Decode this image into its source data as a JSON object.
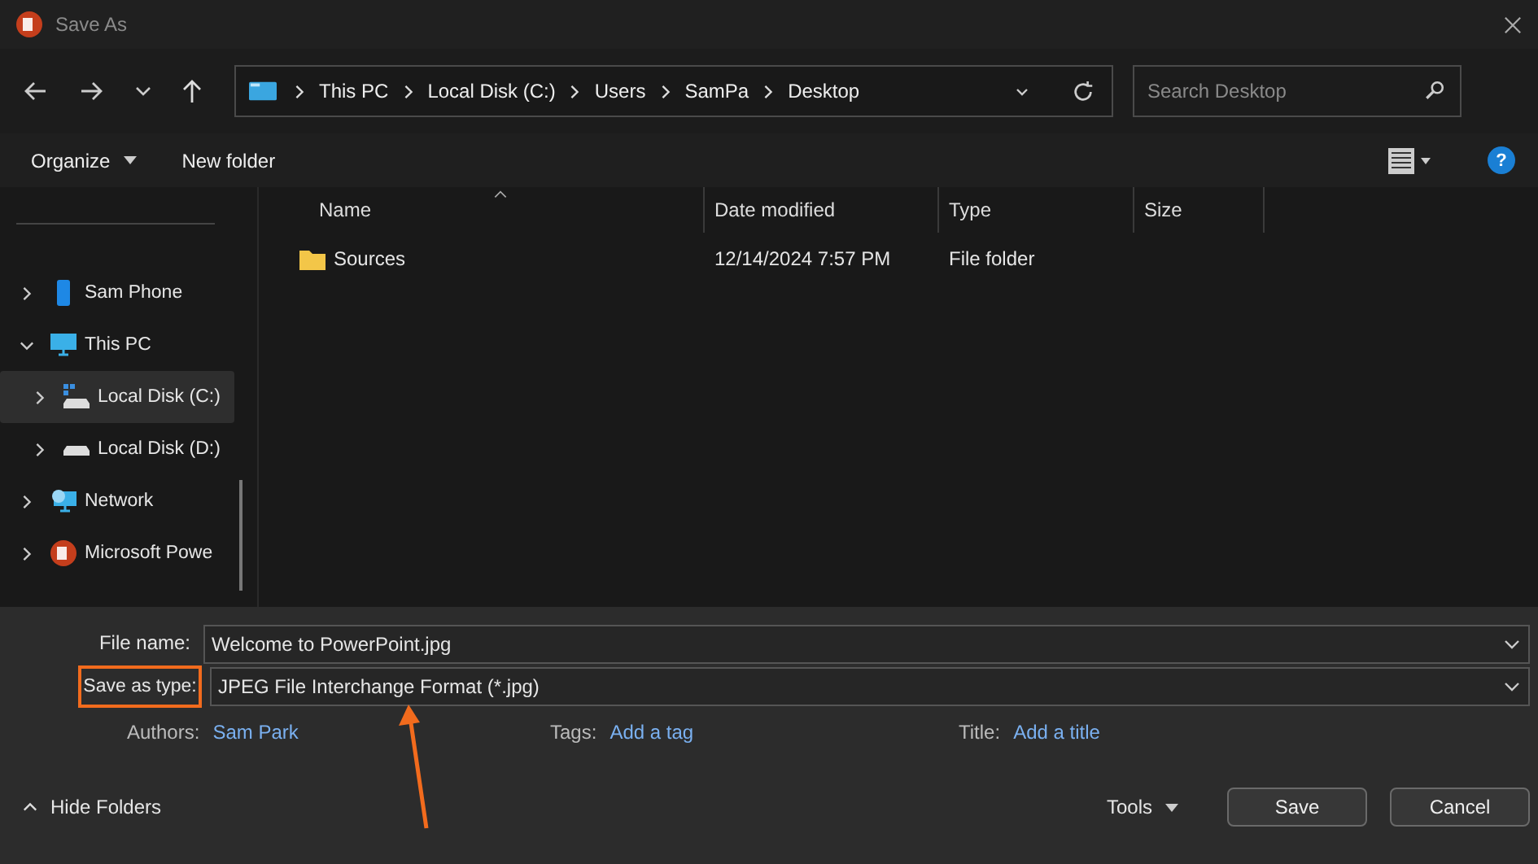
{
  "window": {
    "title": "Save As"
  },
  "breadcrumb": [
    "This PC",
    "Local Disk (C:)",
    "Users",
    "SamPa",
    "Desktop"
  ],
  "search": {
    "placeholder": "Search Desktop"
  },
  "toolbar": {
    "organize": "Organize",
    "new_folder": "New folder",
    "help": "?"
  },
  "sidebar": {
    "items": [
      {
        "label": "Sam Phone",
        "kind": "phone",
        "expanded": false,
        "selected": false
      },
      {
        "label": "This PC",
        "kind": "pc",
        "expanded": true,
        "selected": false,
        "children": [
          {
            "label": "Local Disk (C:)",
            "kind": "system-disk",
            "expanded": false,
            "selected": true
          },
          {
            "label": "Local Disk (D:)",
            "kind": "disk",
            "expanded": false,
            "selected": false
          }
        ]
      },
      {
        "label": "Network",
        "kind": "network",
        "expanded": false,
        "selected": false
      },
      {
        "label": "Microsoft Powe",
        "kind": "app",
        "expanded": false,
        "selected": false
      }
    ]
  },
  "table": {
    "columns": [
      "Name",
      "Date modified",
      "Type",
      "Size"
    ],
    "rows": [
      {
        "name": "Sources",
        "date": "12/14/2024 7:57 PM",
        "type": "File folder"
      }
    ]
  },
  "fields": [
    {
      "label": "File name:",
      "value": "Welcome to PowerPoint.jpg",
      "highlighted": false
    },
    {
      "label": "Save as type:",
      "value": "JPEG File Interchange Format (*.jpg)",
      "highlighted": true
    }
  ],
  "meta": [
    {
      "label": "Authors:",
      "value": "Sam Park"
    },
    {
      "label": "Tags:",
      "value": "Add a tag"
    },
    {
      "label": "Title:",
      "value": "Add a title"
    }
  ],
  "footer": {
    "hide_folders": "Hide Folders",
    "tools": "Tools",
    "buttons": [
      "Save",
      "Cancel"
    ]
  }
}
